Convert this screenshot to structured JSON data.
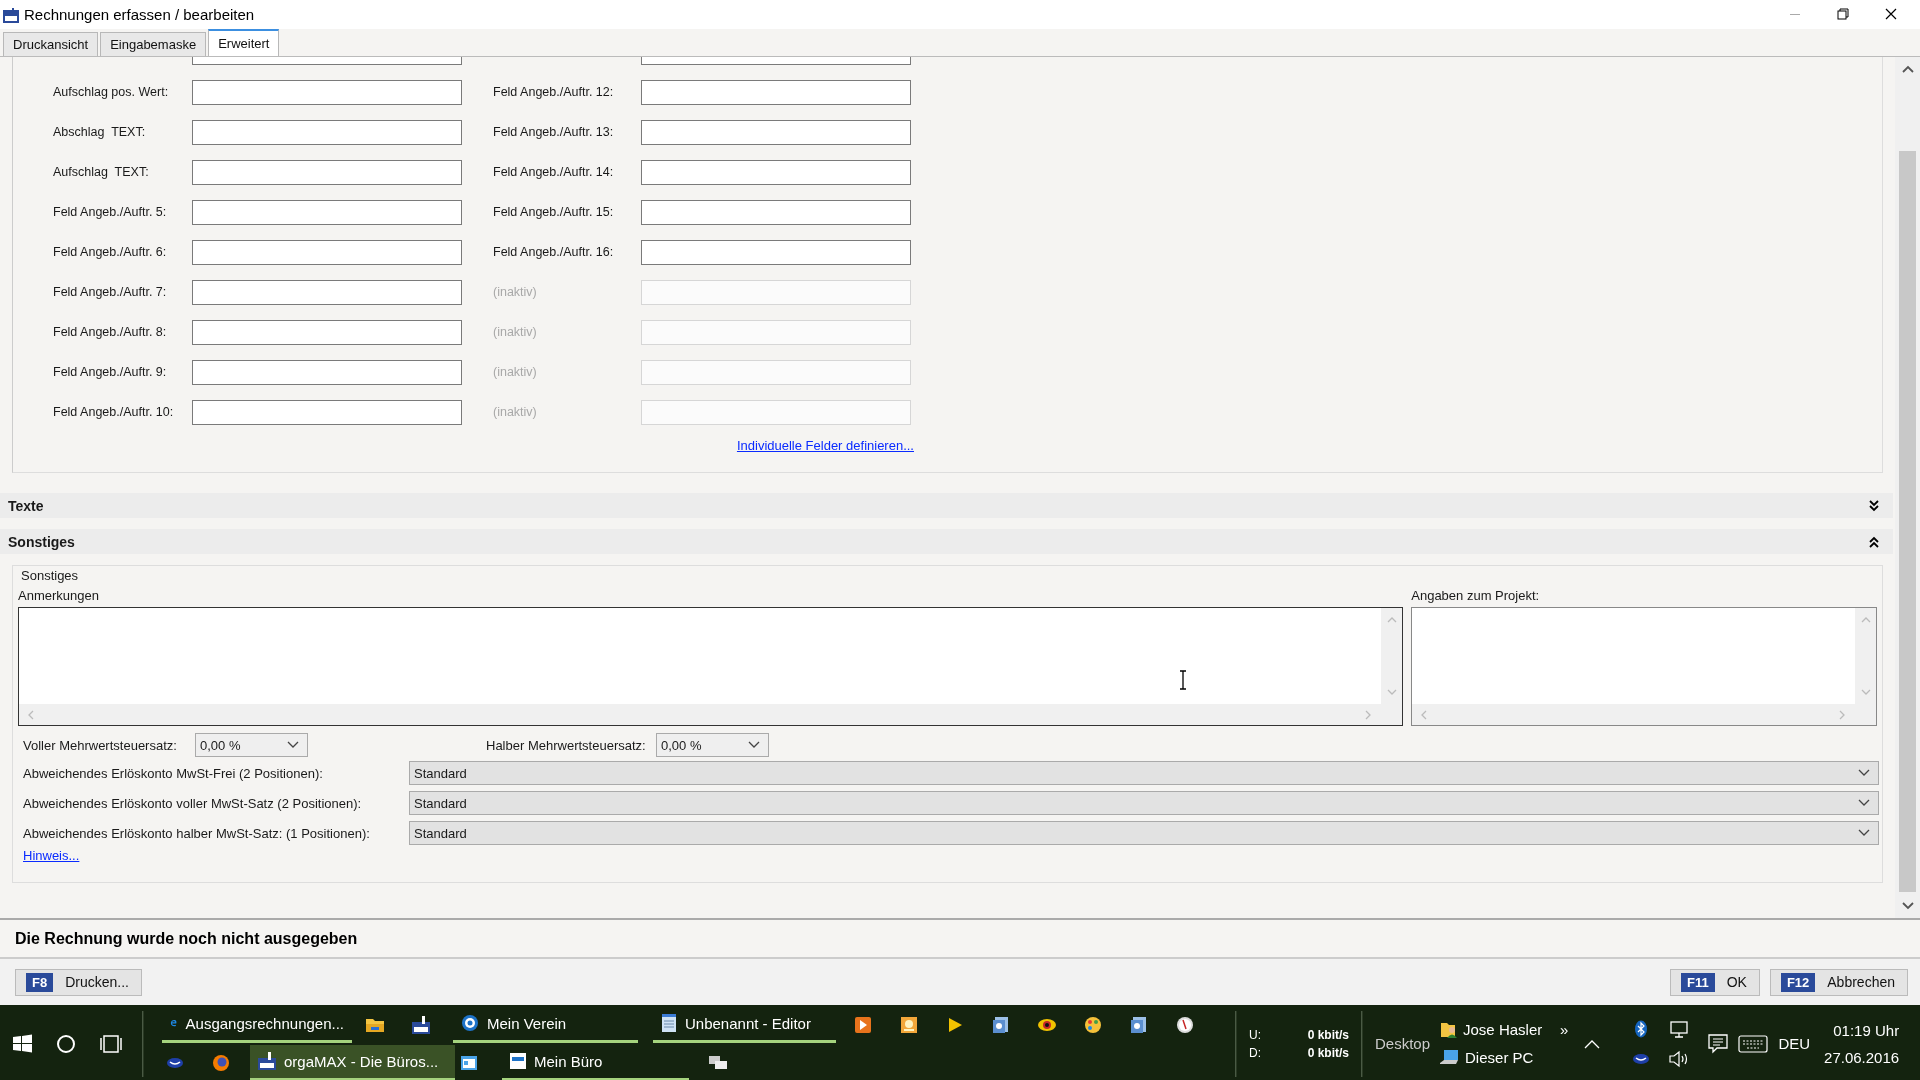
{
  "window": {
    "title": "Rechnungen erfassen / bearbeiten"
  },
  "tabs": [
    {
      "label": "Druckansicht",
      "selected": false
    },
    {
      "label": "Eingabemaske",
      "selected": false
    },
    {
      "label": "Erweitert",
      "selected": true
    }
  ],
  "fields_left": [
    {
      "label": "Aufschlag pos. Wert:"
    },
    {
      "label": "Abschlag  TEXT:"
    },
    {
      "label": "Aufschlag  TEXT:"
    },
    {
      "label": "Feld Angeb./Auftr. 5:"
    },
    {
      "label": "Feld Angeb./Auftr. 6:"
    },
    {
      "label": "Feld Angeb./Auftr. 7:"
    },
    {
      "label": "Feld Angeb./Auftr. 8:"
    },
    {
      "label": "Feld Angeb./Auftr. 9:"
    },
    {
      "label": "Feld Angeb./Auftr. 10:"
    }
  ],
  "fields_right": [
    {
      "label": "Feld Angeb./Auftr. 12:",
      "disabled": false
    },
    {
      "label": "Feld Angeb./Auftr. 13:",
      "disabled": false
    },
    {
      "label": "Feld Angeb./Auftr. 14:",
      "disabled": false
    },
    {
      "label": "Feld Angeb./Auftr. 15:",
      "disabled": false
    },
    {
      "label": "Feld Angeb./Auftr. 16:",
      "disabled": false
    },
    {
      "label": "(inaktiv)",
      "disabled": true
    },
    {
      "label": "(inaktiv)",
      "disabled": true
    },
    {
      "label": "(inaktiv)",
      "disabled": true
    },
    {
      "label": "(inaktiv)",
      "disabled": true
    }
  ],
  "define_link": "Individuelle Felder definieren...",
  "sections": [
    {
      "title": "Texte",
      "expanded": false
    },
    {
      "title": "Sonstiges",
      "expanded": true
    }
  ],
  "sonstiges": {
    "legend": "Sonstiges",
    "notes_label": "Anmerkungen",
    "project_label": "Angaben zum Projekt:",
    "full_vat": {
      "label": "Voller Mehrwertsteuersatz:",
      "value": "0,00 %"
    },
    "half_vat": {
      "label": "Halber Mehrwertsteuersatz:",
      "value": "0,00 %"
    },
    "accounts": [
      {
        "label": "Abweichendes Erlöskonto MwSt-Frei (2 Positionen):",
        "value": "Standard"
      },
      {
        "label": "Abweichendes Erlöskonto voller MwSt-Satz (2 Positionen):",
        "value": "Standard"
      },
      {
        "label": "Abweichendes Erlöskonto halber MwSt-Satz: (1 Positionen):",
        "value": "Standard"
      }
    ],
    "hint_link": "Hinweis..."
  },
  "status_message": "Die Rechnung wurde noch nicht ausgegeben",
  "buttons_left": [
    {
      "key": "F8",
      "label": "Drucken..."
    }
  ],
  "buttons_right": [
    {
      "key": "F11",
      "label": "OK"
    },
    {
      "key": "F12",
      "label": "Abbrechen"
    }
  ],
  "taskbar": {
    "apps": [
      {
        "label": "Ausgangsrechnungen...",
        "active": false
      },
      {
        "label": "Mein Verein",
        "active": false
      },
      {
        "label": "Unbenannt - Editor",
        "active": false
      },
      {
        "label": "orgaMAX - Die Büros...",
        "active": true
      },
      {
        "label": "Mein Büro",
        "active": false
      }
    ],
    "net_up": {
      "label": "U:",
      "value": "0 kbit/s"
    },
    "net_down": {
      "label": "D:",
      "value": "0 kbit/s"
    },
    "desktop": "Desktop",
    "links": [
      "Jose Hasler",
      "Dieser PC"
    ],
    "more": "»",
    "language": "DEU",
    "time": "01:19 Uhr",
    "date": "27.06.2016"
  }
}
